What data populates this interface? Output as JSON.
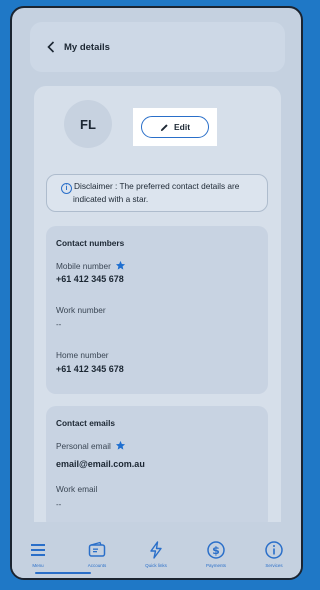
{
  "header": {
    "title": "My details",
    "back_icon": "chevron-left-icon"
  },
  "profile": {
    "initials": "FL",
    "edit_label": "Edit"
  },
  "disclaimer": {
    "line1": "Disclaimer : The preferred contact details are",
    "line2": "indicated with a star."
  },
  "contact_numbers": {
    "title": "Contact numbers",
    "mobile_label": "Mobile number",
    "mobile_value": "+61 412 345 678",
    "work_label": "Work number",
    "work_value": "--",
    "home_label": "Home number",
    "home_value": "+61 412 345 678"
  },
  "contact_emails": {
    "title": "Contact emails",
    "personal_label": "Personal email",
    "personal_value": "email@email.com.au",
    "work_label": "Work email",
    "work_value": "--"
  },
  "nav": {
    "items": [
      {
        "label": "Menu",
        "icon": "menu-icon"
      },
      {
        "label": "Accounts",
        "icon": "wallet-icon"
      },
      {
        "label": "Quick links",
        "icon": "lightning-icon"
      },
      {
        "label": "Payments",
        "icon": "dollar-icon"
      },
      {
        "label": "Services",
        "icon": "info-icon"
      }
    ]
  },
  "colors": {
    "accent": "#2a6fc9",
    "background": "#1f78c6",
    "star": "#1f6fd0"
  }
}
